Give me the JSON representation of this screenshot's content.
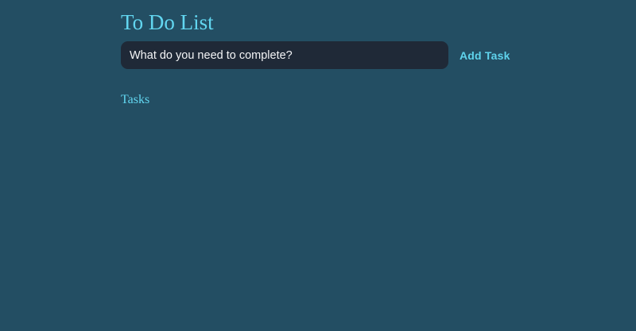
{
  "app": {
    "title": "To Do List"
  },
  "form": {
    "input_placeholder": "What do you need to complete?",
    "input_value": "",
    "add_button_label": "Add Task"
  },
  "tasks": {
    "heading": "Tasks",
    "items": []
  },
  "colors": {
    "background": "#234e63",
    "accent": "#62d6f0",
    "input_background": "#1f2937",
    "input_text": "#f3f4f6"
  }
}
